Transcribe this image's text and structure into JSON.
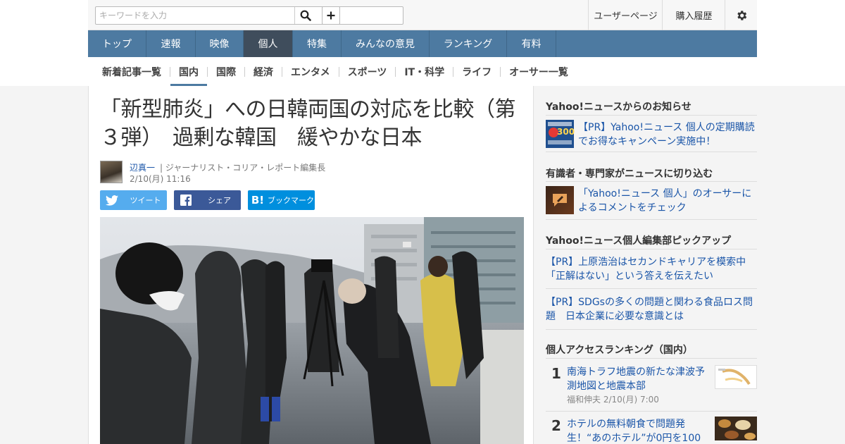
{
  "header": {
    "search_placeholder": "キーワードを入力",
    "user_page": "ユーザーページ",
    "purchase_history": "購入履歴"
  },
  "main_nav": [
    "トップ",
    "速報",
    "映像",
    "個人",
    "特集",
    "みんなの意見",
    "ランキング",
    "有料"
  ],
  "sub_nav": [
    "新着記事一覧",
    "国内",
    "国際",
    "経済",
    "エンタメ",
    "スポーツ",
    "IT・科学",
    "ライフ",
    "オーサー一覧"
  ],
  "article": {
    "title": "「新型肺炎」への日韓両国の対応を比較（第３弾）　過剰な韓国　緩やかな日本",
    "author_name": "辺真一",
    "author_title": "| ジャーナリスト・コリア・レポート編集長",
    "date": "2/10(月) 11:16",
    "share": {
      "tweet": "ツイート",
      "facebook": "シェア",
      "hatena_icon_text": "B!",
      "bookmark": "ブックマーク"
    }
  },
  "sidebar": {
    "notice_heading": "Yahoo!ニュースからのお知らせ",
    "notice_link": "【PR】Yahoo!ニュース 個人の定期購読でお得なキャンペーン実施中！",
    "notice_thumb_amount": "300",
    "experts_heading": "有識者・専門家がニュースに切り込む",
    "experts_link": "「Yahoo!ニュース 個人」のオーサーによるコメントをチェック",
    "pickup_heading": "Yahoo!ニュース個人編集部ピックアップ",
    "pickup_links": [
      "【PR】上原浩治はセカンドキャリアを模索中「正解はない」という答えを伝えたい",
      "【PR】SDGsの多くの問題と関わる食品ロス問題　日本企業に必要な意識とは"
    ],
    "ranking_heading": "個人アクセスランキング（国内）",
    "ranking": [
      {
        "rank": "1",
        "title": "南海トラフ地震の新たな津波予測地図と地震本部",
        "meta": "福和伸夫  2/10(月) 7:00"
      },
      {
        "rank": "2",
        "title": "ホテルの無料朝食で問題発生！“あのホテル”が0円を100円",
        "meta": ""
      }
    ]
  },
  "colors": {
    "nav_blue": "#4d7aa1",
    "nav_active": "#3f4d5c",
    "link_blue": "#1a55a8",
    "twitter": "#55acee",
    "facebook": "#3b5998",
    "hatena": "#008fde"
  }
}
